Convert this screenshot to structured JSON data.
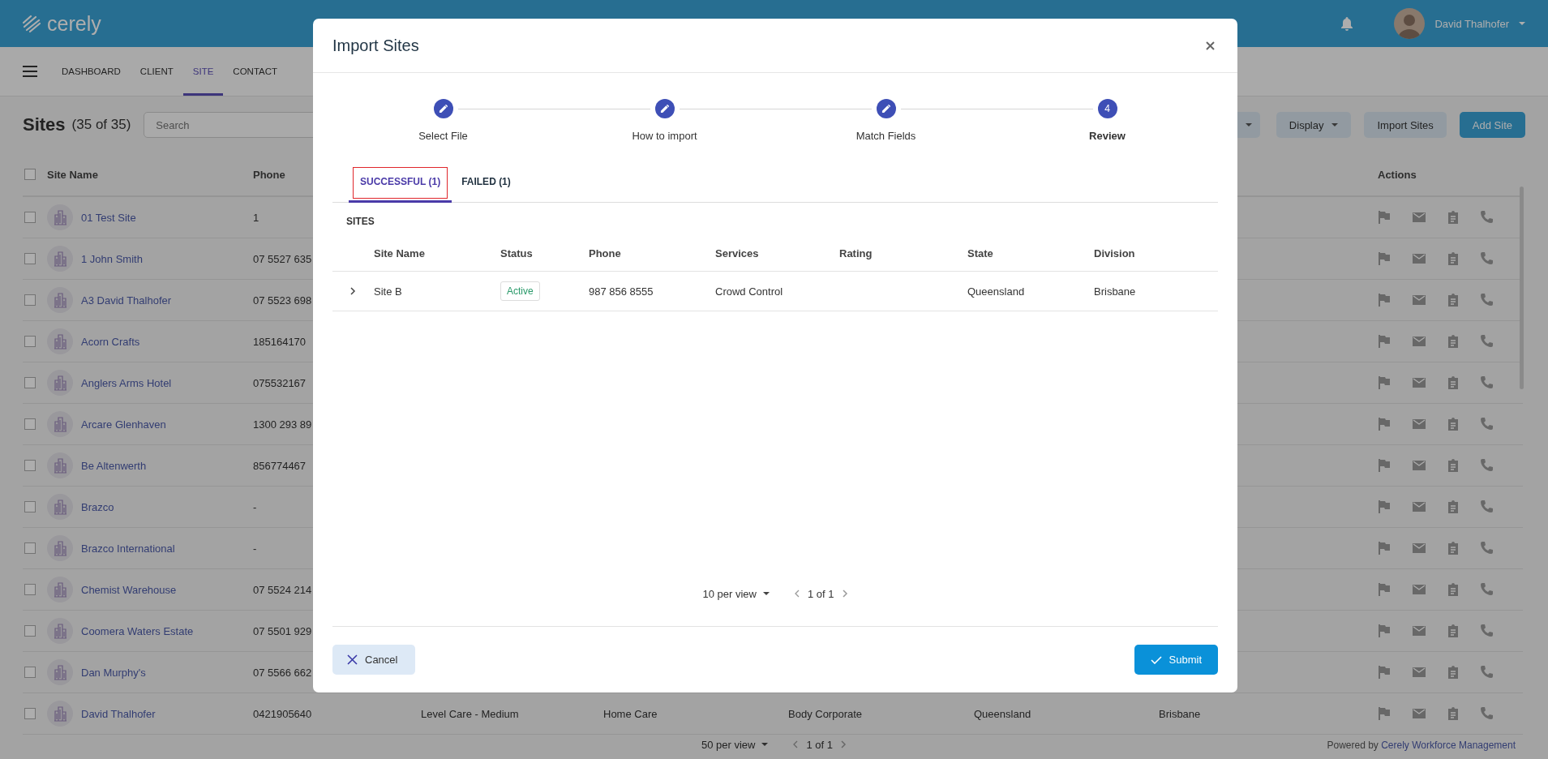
{
  "header": {
    "logo": "cerely",
    "user": {
      "name": "David Thalhofer"
    }
  },
  "nav": {
    "items": [
      {
        "label": "DASHBOARD",
        "selected": false
      },
      {
        "label": "CLIENT",
        "selected": false
      },
      {
        "label": "SITE",
        "selected": true
      },
      {
        "label": "CONTACT",
        "selected": false
      }
    ]
  },
  "sites": {
    "title": "Sites",
    "count": "(35 of 35)",
    "search": {
      "placeholder": "Search"
    },
    "buttons": [
      {
        "label": "Display",
        "kind": "dropdown"
      },
      {
        "label": "Import Sites",
        "kind": "secondary"
      },
      {
        "label": "Add Site",
        "kind": "primary"
      }
    ],
    "select_all": {
      "checked": false
    },
    "columns": [
      {
        "label": "Site Name",
        "kind": "name"
      },
      {
        "label": "Phone",
        "kind": "phone"
      },
      {
        "label": "Actions",
        "kind": "actions"
      }
    ],
    "rows": [
      {
        "name": "01 Test Site",
        "phone": "1",
        "checked": false
      },
      {
        "name": "1 John Smith",
        "phone": "07 5527 635",
        "checked": false
      },
      {
        "name": "A3 David Thalhofer",
        "phone": "07 5523 698",
        "checked": false
      },
      {
        "name": "Acorn Crafts",
        "phone": "185164170",
        "checked": false
      },
      {
        "name": "Anglers Arms Hotel",
        "phone": "075532167",
        "checked": false
      },
      {
        "name": "Arcare Glenhaven",
        "phone": "1300 293 89",
        "checked": false
      },
      {
        "name": "Be Altenwerth",
        "phone": "856774467",
        "checked": false
      },
      {
        "name": "Brazco",
        "phone": "-",
        "checked": false
      },
      {
        "name": "Brazco International",
        "phone": "-",
        "checked": false
      },
      {
        "name": "Chemist Warehouse",
        "phone": "07 5524 214",
        "checked": false
      },
      {
        "name": "Coomera Waters Estate",
        "phone": "07 5501 929",
        "checked": false
      },
      {
        "name": "Dan Murphy's",
        "phone": "07 5566 662",
        "checked": false
      },
      {
        "name": "David Thalhofer",
        "phone": "0421905640",
        "checked": false,
        "cells": [
          "Level Care - Medium",
          "Home Care",
          "Body Corporate",
          "Queensland",
          "Brisbane"
        ]
      }
    ],
    "pagination": {
      "per_view": "50 per view",
      "pages": "1 of 1"
    },
    "footer": {
      "text": "Powered by",
      "link": "Cerely Workforce Management"
    }
  },
  "modal": {
    "title": "Import Sites",
    "steps": [
      {
        "label": "Select File",
        "kind": "done"
      },
      {
        "label": "How to import",
        "kind": "done"
      },
      {
        "label": "Match Fields",
        "kind": "done"
      },
      {
        "label": "Review",
        "kind": "current",
        "number": "4"
      }
    ],
    "tabs": [
      {
        "label": "SUCCESSFUL (1)",
        "selected": true,
        "highlighted": true
      },
      {
        "label": "FAILED (1)",
        "selected": false,
        "highlighted": false
      }
    ],
    "section": "SITES",
    "table": {
      "columns": [
        "Site Name",
        "Status",
        "Phone",
        "Services",
        "Rating",
        "State",
        "Division"
      ],
      "rows": [
        {
          "expanded": false,
          "site_name": "Site B",
          "status": "Active",
          "phone": "987 856 8555",
          "services": "Crowd Control",
          "state": "Queensland",
          "division": "Brisbane"
        }
      ]
    },
    "pagination": {
      "per_view": "10 per view",
      "pages": "1 of 1"
    },
    "buttons": [
      {
        "label": "Cancel",
        "kind": "cancel"
      },
      {
        "label": "Submit",
        "kind": "submit"
      }
    ]
  }
}
